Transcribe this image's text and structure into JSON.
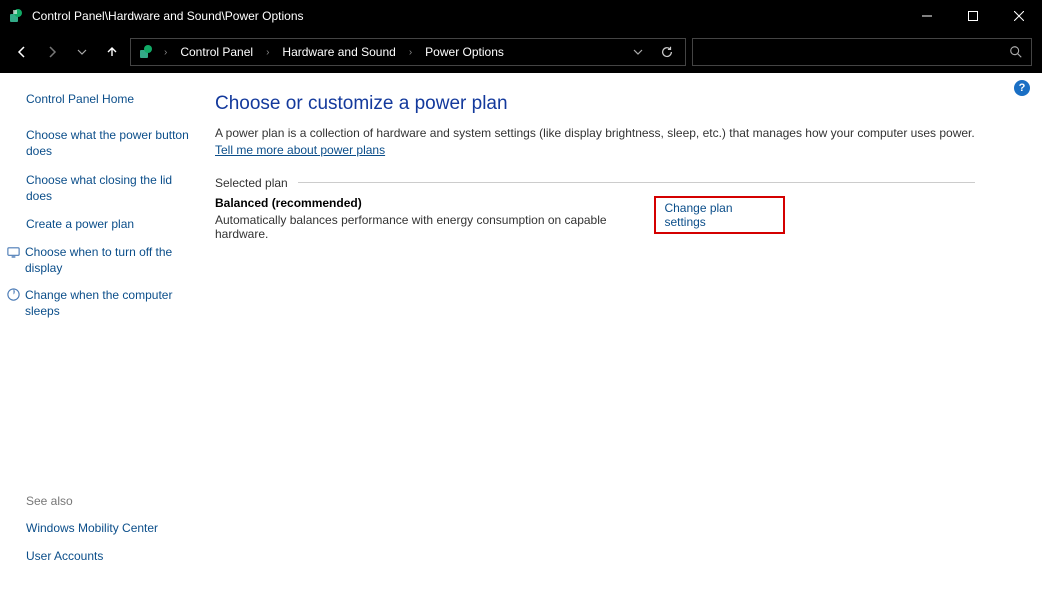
{
  "window": {
    "title": "Control Panel\\Hardware and Sound\\Power Options"
  },
  "breadcrumbs": {
    "items": [
      "Control Panel",
      "Hardware and Sound",
      "Power Options"
    ]
  },
  "sidebar": {
    "home": "Control Panel Home",
    "links": [
      "Choose what the power button does",
      "Choose what closing the lid does",
      "Create a power plan",
      "Choose when to turn off the display",
      "Change when the computer sleeps"
    ],
    "see_also_label": "See also",
    "see_also": [
      "Windows Mobility Center",
      "User Accounts"
    ]
  },
  "main": {
    "heading": "Choose or customize a power plan",
    "description_pre": "A power plan is a collection of hardware and system settings (like display brightness, sleep, etc.) that manages how your computer uses power. ",
    "description_link": "Tell me more about power plans",
    "group_label": "Selected plan",
    "plan": {
      "name": "Balanced (recommended)",
      "desc": "Automatically balances performance with energy consumption on capable hardware.",
      "change_link": "Change plan settings"
    }
  },
  "icons": {
    "help": "?"
  }
}
